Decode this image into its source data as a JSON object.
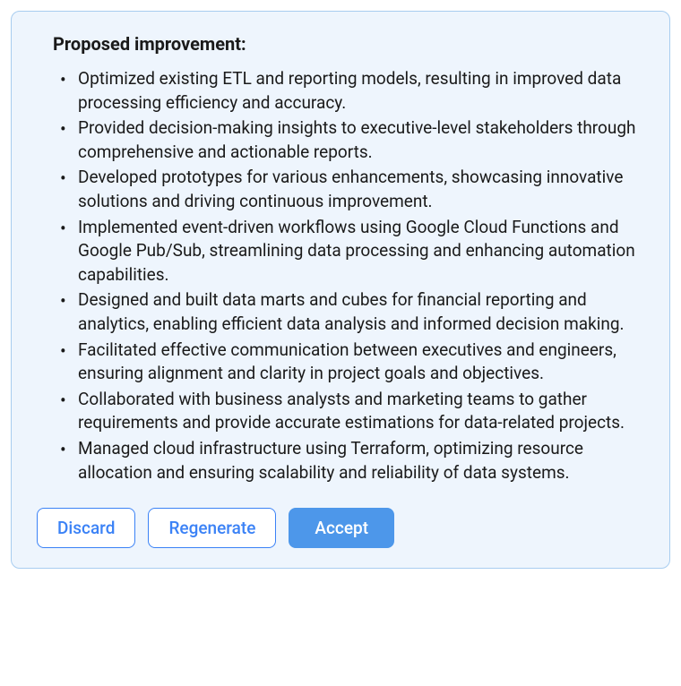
{
  "card": {
    "title": "Proposed improvement:",
    "bullets": [
      "Optimized existing ETL and reporting models, resulting in improved data processing efficiency and accuracy.",
      "Provided decision-making insights to executive-level stakeholders through comprehensive and actionable reports.",
      "Developed prototypes for various enhancements, showcasing innovative solutions and driving continuous improvement.",
      "Implemented event-driven workflows using Google Cloud Functions and Google Pub/Sub, streamlining data processing and enhancing automation capabilities.",
      "Designed and built data marts and cubes for financial reporting and analytics, enabling efficient data analysis and informed decision making.",
      "Facilitated effective communication between executives and engineers, ensuring alignment and clarity in project goals and objectives.",
      "Collaborated with business analysts and marketing teams to gather requirements and provide accurate estimations for data-related projects.",
      "Managed cloud infrastructure using Terraform, optimizing resource allocation and ensuring scalability and reliability of data systems."
    ],
    "buttons": {
      "discard": "Discard",
      "regenerate": "Regenerate",
      "accept": "Accept"
    }
  }
}
